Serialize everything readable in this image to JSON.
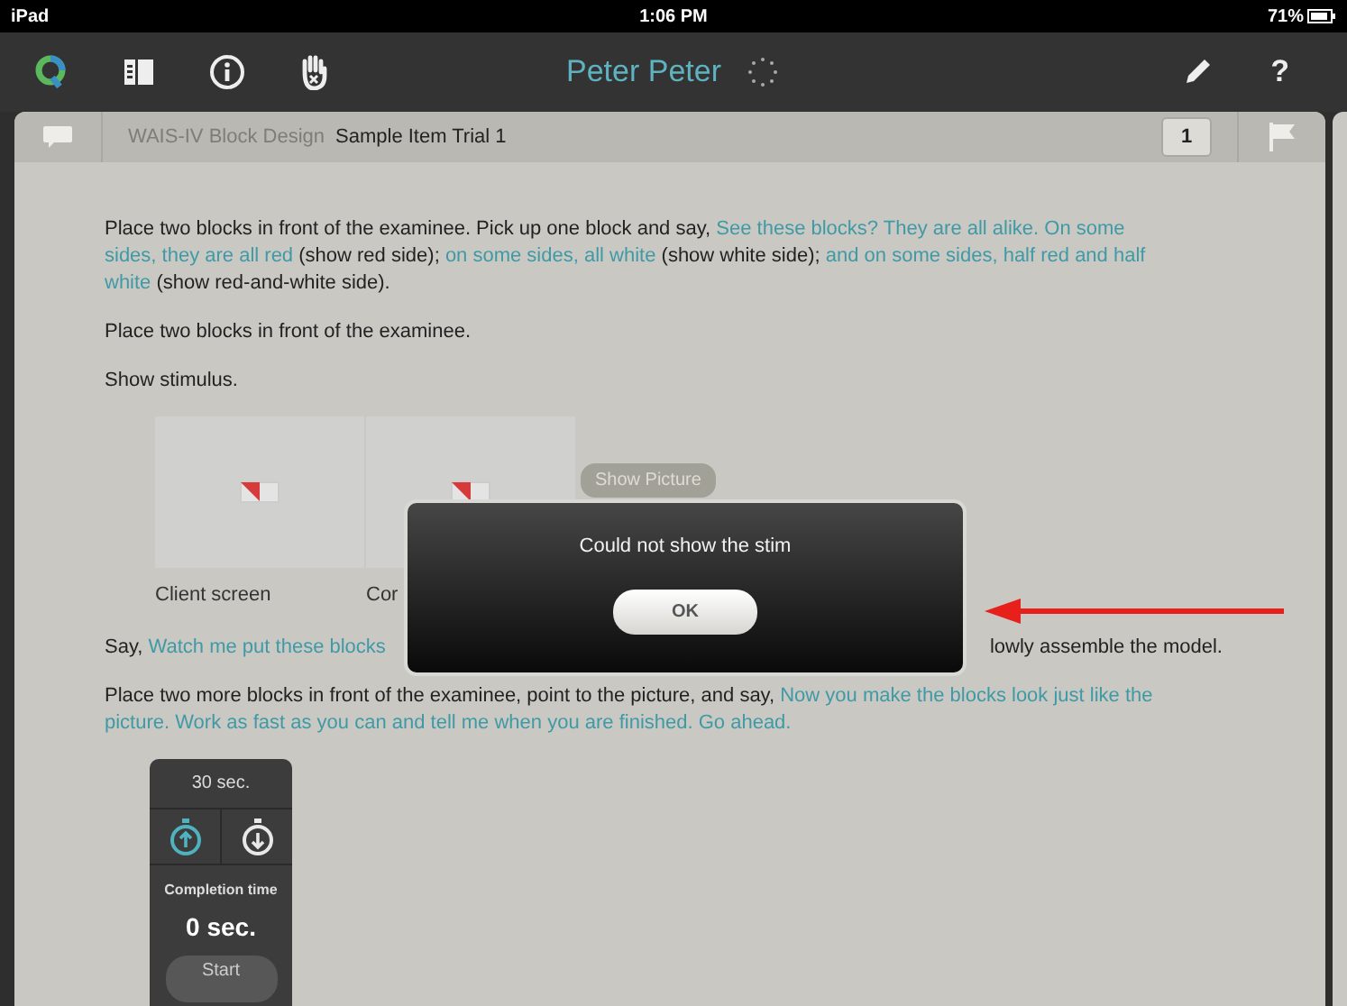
{
  "status_bar": {
    "device": "iPad",
    "time": "1:06 PM",
    "battery": "71%"
  },
  "toolbar": {
    "title": "Peter Peter",
    "help": "?"
  },
  "header": {
    "subtest": "WAIS-IV Block Design",
    "item": "Sample Item Trial 1",
    "count": "1"
  },
  "intro": [
    [
      {
        "kind": "plain",
        "text": "Place two blocks in front of the examinee. Pick up one block and say, "
      },
      {
        "kind": "say",
        "text": "See these blocks? They are all alike. On some sides, they are all red"
      },
      {
        "kind": "plain",
        "text": " (show red side); "
      },
      {
        "kind": "say",
        "text": "on some sides, all white"
      },
      {
        "kind": "plain",
        "text": " (show white side); "
      },
      {
        "kind": "say",
        "text": "and on some sides, half red and half white"
      },
      {
        "kind": "plain",
        "text": " (show red-and-white side)."
      }
    ],
    [
      {
        "kind": "plain",
        "text": "Place two blocks in front of the examinee."
      }
    ],
    [
      {
        "kind": "plain",
        "text": "Show stimulus."
      }
    ]
  ],
  "stimulus": {
    "panels": [
      {
        "caption": "Client screen"
      },
      {
        "caption": "Cor"
      }
    ],
    "button": "Show Picture"
  },
  "say_line": {
    "left": [
      {
        "kind": "plain",
        "text": "Say, "
      },
      {
        "kind": "say",
        "text": "Watch me put these blocks"
      }
    ],
    "right": "lowly assemble the model."
  },
  "final": [
    [
      {
        "kind": "plain",
        "text": "Place two more blocks in front of the examinee, point to the picture, and say, "
      },
      {
        "kind": "say",
        "text": "Now you make the blocks look just like the picture. Work as fast as you can and tell me when you are finished. Go ahead."
      }
    ]
  ],
  "timer": {
    "limit": "30 sec.",
    "modes": [
      {
        "kind": "up",
        "selected": true
      },
      {
        "kind": "down",
        "selected": false
      }
    ],
    "caption": "Completion time",
    "value": "0 sec.",
    "button": "Start"
  },
  "dialog": {
    "message": "Could not show the stim",
    "button": "OK"
  }
}
